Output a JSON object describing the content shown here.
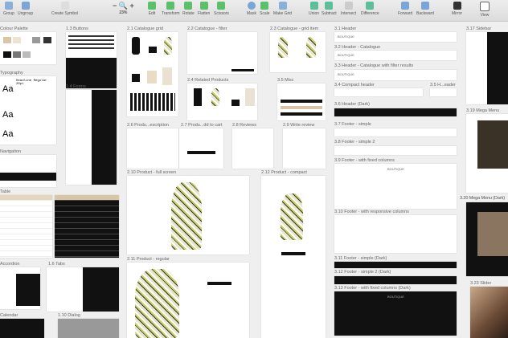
{
  "toolbar": {
    "group": "Group",
    "ungroup": "Ungroup",
    "create_symbol": "Create Symbol",
    "zoom": "23%",
    "edit": "Edit",
    "transform": "Transform",
    "rotate": "Rotate",
    "flatten": "Flatten",
    "scissors": "Scissors",
    "mask": "Mask",
    "scale": "Scale",
    "make_grid": "Make Grid",
    "union": "Union",
    "subtract": "Subtract",
    "intersect": "Intersect",
    "difference": "Difference",
    "forward": "Forward",
    "backward": "Backward",
    "mirror": "Mirror",
    "view": "View"
  },
  "artboards": {
    "colour_palette": "Colour Palette",
    "typography": "Typography",
    "navigation": "Navigation",
    "table": "Table",
    "accordion": "Accordion",
    "calendar": "Calendar",
    "buttons": "1.3 Buttons",
    "forms": "1.4 Forms",
    "tabs": "1.6 Tabs",
    "dialog": "1.10 Dialog",
    "catalogue_grid": "2.1 Catalogue grid",
    "catalogue_filter": "2.2 Catalogue - filter",
    "catalogue_grid_item": "2.3 Catalogue - grid item",
    "related_products": "2.4 Related Products",
    "misc": "3.5 Misc",
    "product_description": "2.6 Produ...escription",
    "product_add_to_cart": "2.7 Produ...dd to cart",
    "reviews": "2.8 Reviews",
    "write_review": "2.9 Write review",
    "product_full": "2.10 Product - full screen",
    "product_regular": "2.11 Product - regular",
    "product_compact": "2.12 Product - compact",
    "header": "3.1 Header",
    "header_catalogue": "3.2 Header - Catalogue",
    "header_catalogue_filter": "3.3 Header - Catalogue with filter results",
    "compact_header": "3.4 Compact header",
    "header_35": "3.5 H...eader",
    "header_dark": "3.6 Header (Dark)",
    "footer_simple": "3.7 Footer - simple",
    "footer_simple2": "3.8 Footer - simple 2",
    "footer_fixed": "3.9 Footer - with fixed columns",
    "footer_responsive": "3.10 Footer - with responsive columns",
    "footer_simple_dark": "3.11 Footer - simple (Dark)",
    "footer_simple2_dark": "3.12 Footer - simple 2 (Dark)",
    "footer_fixed_dark": "3.13 Footer - with fixed columns (Dark)",
    "sidebar": "3.17 Sidebar",
    "mega_menu": "3.19 Mega Menu",
    "mega_menu_dark": "3.20 Mega Menu (Dark)",
    "slider": "3.23 Slider"
  },
  "typography_sample": {
    "aa": "Aa",
    "headline": "Headline Regular 20pt"
  },
  "brand": "BOUTIQUE"
}
